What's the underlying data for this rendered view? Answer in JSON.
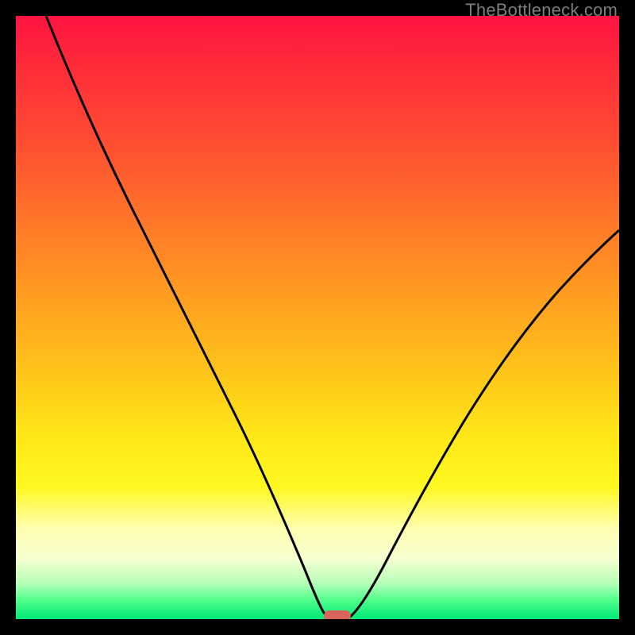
{
  "watermark": "TheBottleneck.com",
  "chart_data": {
    "type": "line",
    "title": "",
    "xlabel": "",
    "ylabel": "",
    "xlim": [
      0,
      100
    ],
    "ylim": [
      0,
      100
    ],
    "grid": false,
    "background_gradient": [
      "#ff1440",
      "#ff7a28",
      "#ffe818",
      "#fffeb0",
      "#00e676"
    ],
    "series": [
      {
        "name": "curve",
        "x": [
          5,
          10,
          15,
          20,
          25,
          30,
          35,
          40,
          45,
          48,
          50,
          52,
          54,
          56,
          60,
          65,
          70,
          75,
          80,
          85,
          90,
          95,
          100
        ],
        "y": [
          100,
          92,
          83,
          74,
          65,
          55,
          44,
          32,
          18,
          8,
          2,
          0,
          0,
          2,
          12,
          24,
          34,
          42,
          49,
          55,
          60,
          64,
          68
        ]
      }
    ],
    "marker": {
      "x": 52.5,
      "y": 0,
      "shape": "rounded-rect",
      "color": "#d9645c"
    }
  }
}
